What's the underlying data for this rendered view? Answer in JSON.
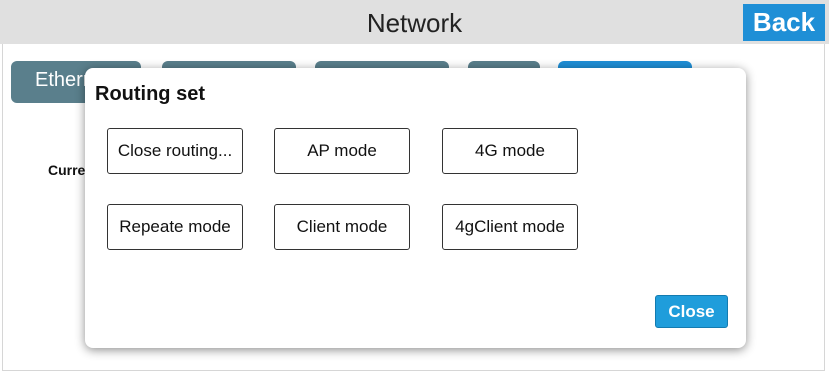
{
  "header": {
    "title": "Network",
    "back_label": "Back"
  },
  "tabs": [
    {
      "label": "Ethernet"
    },
    {
      "label": ""
    },
    {
      "label": ""
    },
    {
      "label": ""
    },
    {
      "label": ""
    }
  ],
  "background": {
    "current_label": "Current"
  },
  "modal": {
    "title": "Routing set",
    "buttons": [
      {
        "label": "Close routing..."
      },
      {
        "label": "AP mode"
      },
      {
        "label": "4G mode"
      },
      {
        "label": "Repeate mode"
      },
      {
        "label": "Client mode"
      },
      {
        "label": "4gClient mode"
      }
    ],
    "close_label": "Close"
  },
  "colors": {
    "accent": "#1f8fd6",
    "tab": "#5a7f8c",
    "header_bg": "#e0e0e0"
  }
}
